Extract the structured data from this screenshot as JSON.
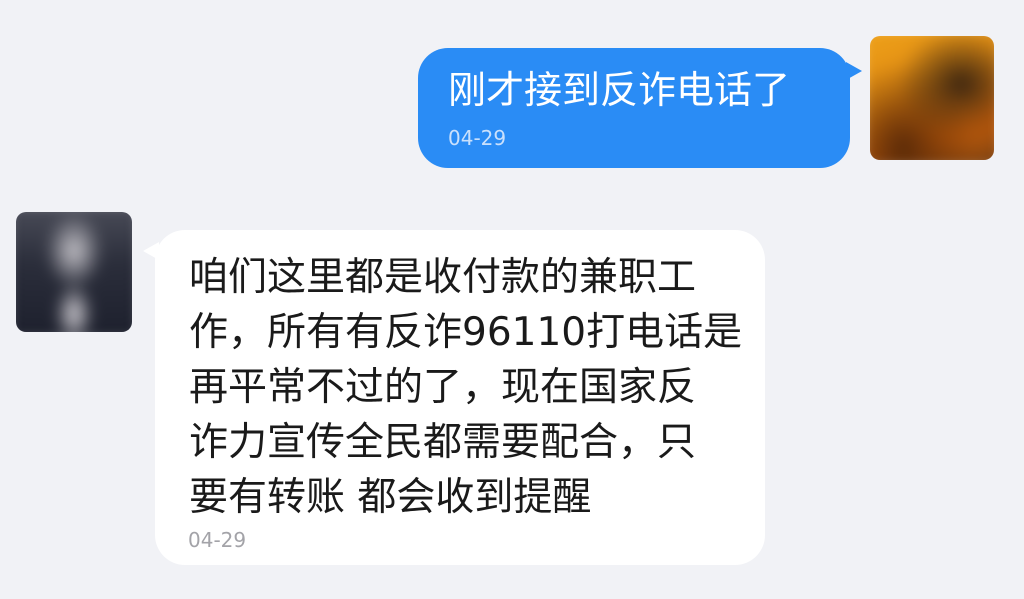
{
  "chat": {
    "outgoing": {
      "text": "刚才接到反诈电话了",
      "time": "04-29"
    },
    "incoming": {
      "lines": [
        "咱们这里都是收付款的兼职工",
        "作，所有有反诈96110打电话是",
        "再平常不过的了，现在国家反",
        "诈力宣传全民都需要配合，只",
        "要有转账 都会收到提醒"
      ],
      "time": "04-29"
    }
  },
  "colors": {
    "background": "#f1f2f6",
    "outgoing_bubble": "#2a8cf5",
    "incoming_bubble": "#ffffff",
    "incoming_text": "#1a1a1a",
    "timestamp_gray": "#a3a3a8"
  }
}
